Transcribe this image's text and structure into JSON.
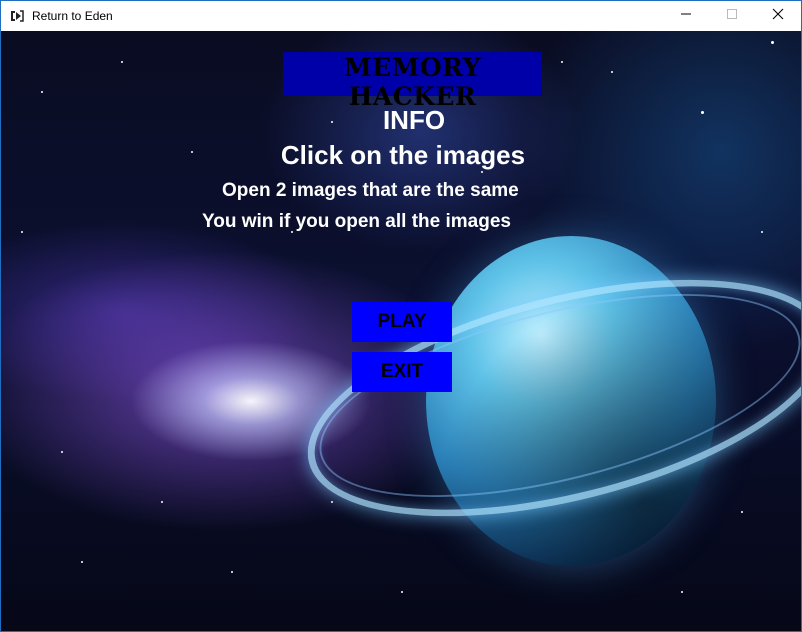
{
  "window": {
    "title": "Return to Eden",
    "icons": {
      "app": "app-logo-icon",
      "minimize": "minimize-icon",
      "maximize": "maximize-icon",
      "close": "close-icon"
    }
  },
  "game": {
    "logo": "MEMORY HACKER",
    "info_title": "INFO",
    "info_subtitle": "Click on the images",
    "rules": [
      "Open 2 images that are the same",
      "You win if you open all the images"
    ],
    "buttons": {
      "play": "PLAY",
      "exit": "EXIT"
    },
    "colors": {
      "logo_bg": "#0000a8",
      "button_bg": "#0000ff",
      "text": "#ffffff"
    }
  }
}
